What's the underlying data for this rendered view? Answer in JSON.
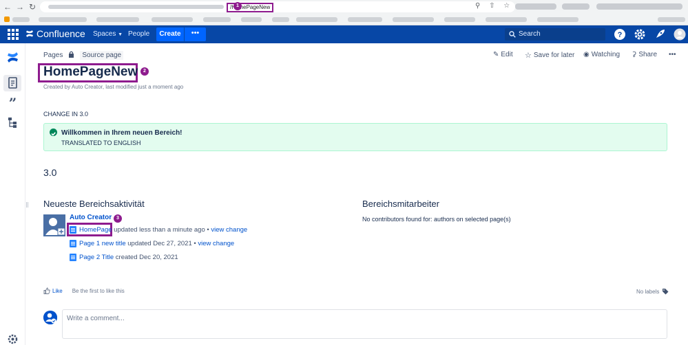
{
  "browser": {
    "url_suffix": "/HomePageNew",
    "badge_1": "1"
  },
  "topnav": {
    "brand": "Confluence",
    "spaces": "Spaces",
    "people": "People",
    "create": "Create",
    "more": "•••",
    "search_placeholder": "Search"
  },
  "breadcrumb": {
    "pages": "Pages",
    "source": "Source page"
  },
  "actions": {
    "edit": "Edit",
    "save_for_later": "Save for later",
    "watching": "Watching",
    "share": "Share",
    "more": "•••"
  },
  "page": {
    "title": "HomePageNew",
    "badge_2": "2",
    "byline": "Created by Auto Creator, last modified just a moment ago",
    "change_text": "CHANGE IN 3.0",
    "panel_title": "Willkommen in Ihrem neuen Bereich!",
    "panel_body": "TRANSLATED TO ENGLISH",
    "version": "3.0"
  },
  "activity": {
    "heading": "Neueste Bereichsaktivität",
    "author": "Auto Creator",
    "badge_3": "3",
    "items": [
      {
        "page": "HomePage",
        "text": " updated less than a minute ago • ",
        "link": "view change"
      },
      {
        "page": "Page 1 new title",
        "text": " updated Dec 27, 2021 • ",
        "link": "view change"
      },
      {
        "page": "Page 2 Title",
        "text": " created Dec 20, 2021",
        "link": ""
      }
    ]
  },
  "contributors": {
    "heading": "Bereichsmitarbeiter",
    "empty_text": "No contributors found for: authors on selected page(s)"
  },
  "footer": {
    "like": "Like",
    "be_first": "Be the first to like this",
    "no_labels": "No labels",
    "comment_placeholder": "Write a comment..."
  },
  "colors": {
    "nav_bg": "#0747a6",
    "create_bg": "#0065ff",
    "highlight": "#8e1b8e",
    "success_bg": "#e3fcef",
    "link": "#0052cc"
  }
}
